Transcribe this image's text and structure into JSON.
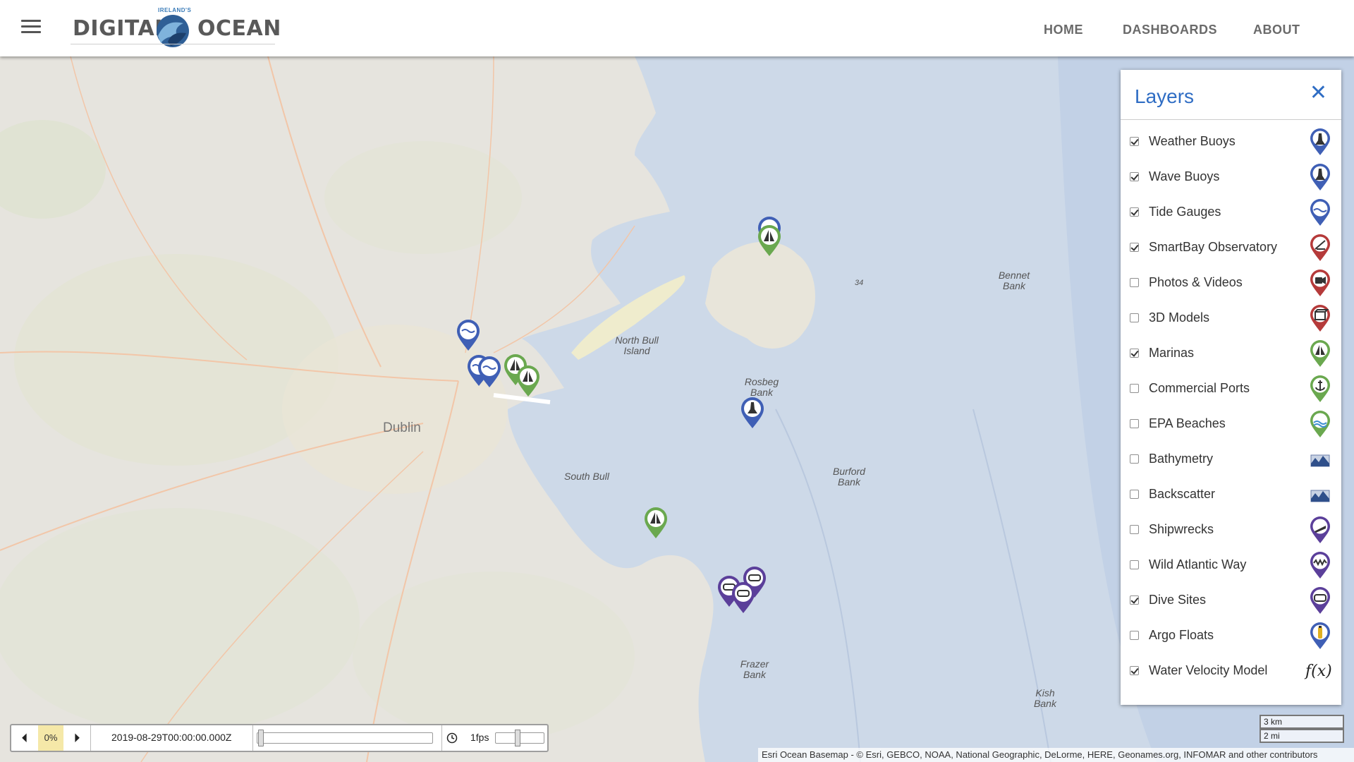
{
  "header": {
    "logo_left": "DIGITAL",
    "logo_right": "OCEAN",
    "logo_small": "IRELAND'S",
    "nav": [
      {
        "label": "HOME"
      },
      {
        "label": "DASHBOARDS"
      },
      {
        "label": "ABOUT"
      }
    ]
  },
  "map": {
    "city_label": "Dublin",
    "labels": [
      "North Bull Island",
      "Rosbeg Bank",
      "South Bull",
      "Burford Bank",
      "Bennet Bank",
      "Frazer Bank",
      "Kish Bank",
      "34"
    ],
    "scale": [
      "3 km",
      "2 mi"
    ],
    "attribution": "Esri Ocean Basemap - © Esri, GEBCO, NOAA, National Geographic, DeLorme, HERE, Geonames.org, INFOMAR and other contributors"
  },
  "layers_panel": {
    "title": "Layers",
    "close_label": "✕",
    "items": [
      {
        "label": "Weather Buoys",
        "checked": true,
        "icon": "buoy-icon",
        "color": "#3f5fb5"
      },
      {
        "label": "Wave Buoys",
        "checked": true,
        "icon": "buoy-icon",
        "color": "#3f5fb5"
      },
      {
        "label": "Tide Gauges",
        "checked": true,
        "icon": "wave-icon",
        "color": "#3f5fb5"
      },
      {
        "label": "SmartBay Observatory",
        "checked": true,
        "icon": "observatory-icon",
        "color": "#b53a3a"
      },
      {
        "label": "Photos & Videos",
        "checked": false,
        "icon": "camera-icon",
        "color": "#b53a3a"
      },
      {
        "label": "3D Models",
        "checked": false,
        "icon": "3d-model-icon",
        "color": "#b53a3a"
      },
      {
        "label": "Marinas",
        "checked": true,
        "icon": "sailboat-icon",
        "color": "#6aa84f"
      },
      {
        "label": "Commercial Ports",
        "checked": false,
        "icon": "anchor-icon",
        "color": "#6aa84f"
      },
      {
        "label": "EPA Beaches",
        "checked": false,
        "icon": "beach-icon",
        "color": "#6aa84f"
      },
      {
        "label": "Bathymetry",
        "checked": false,
        "icon": "bathymetry-icon",
        "color": "#6a7ca8"
      },
      {
        "label": "Backscatter",
        "checked": false,
        "icon": "backscatter-icon",
        "color": "#6a7ca8"
      },
      {
        "label": "Shipwrecks",
        "checked": false,
        "icon": "shipwreck-icon",
        "color": "#5b3f9a"
      },
      {
        "label": "Wild Atlantic Way",
        "checked": false,
        "icon": "wild-atlantic-way-icon",
        "color": "#5b3f9a"
      },
      {
        "label": "Dive Sites",
        "checked": true,
        "icon": "dive-mask-icon",
        "color": "#5b3f9a"
      },
      {
        "label": "Argo Floats",
        "checked": false,
        "icon": "argo-float-icon",
        "color": "#3f5fb5"
      },
      {
        "label": "Water Velocity Model",
        "checked": true,
        "icon": "function-icon",
        "color": "#222222"
      }
    ]
  },
  "timebar": {
    "percent": "0%",
    "datetime": "2019-08-29T00:00:00.000Z",
    "fps": "1fps"
  }
}
